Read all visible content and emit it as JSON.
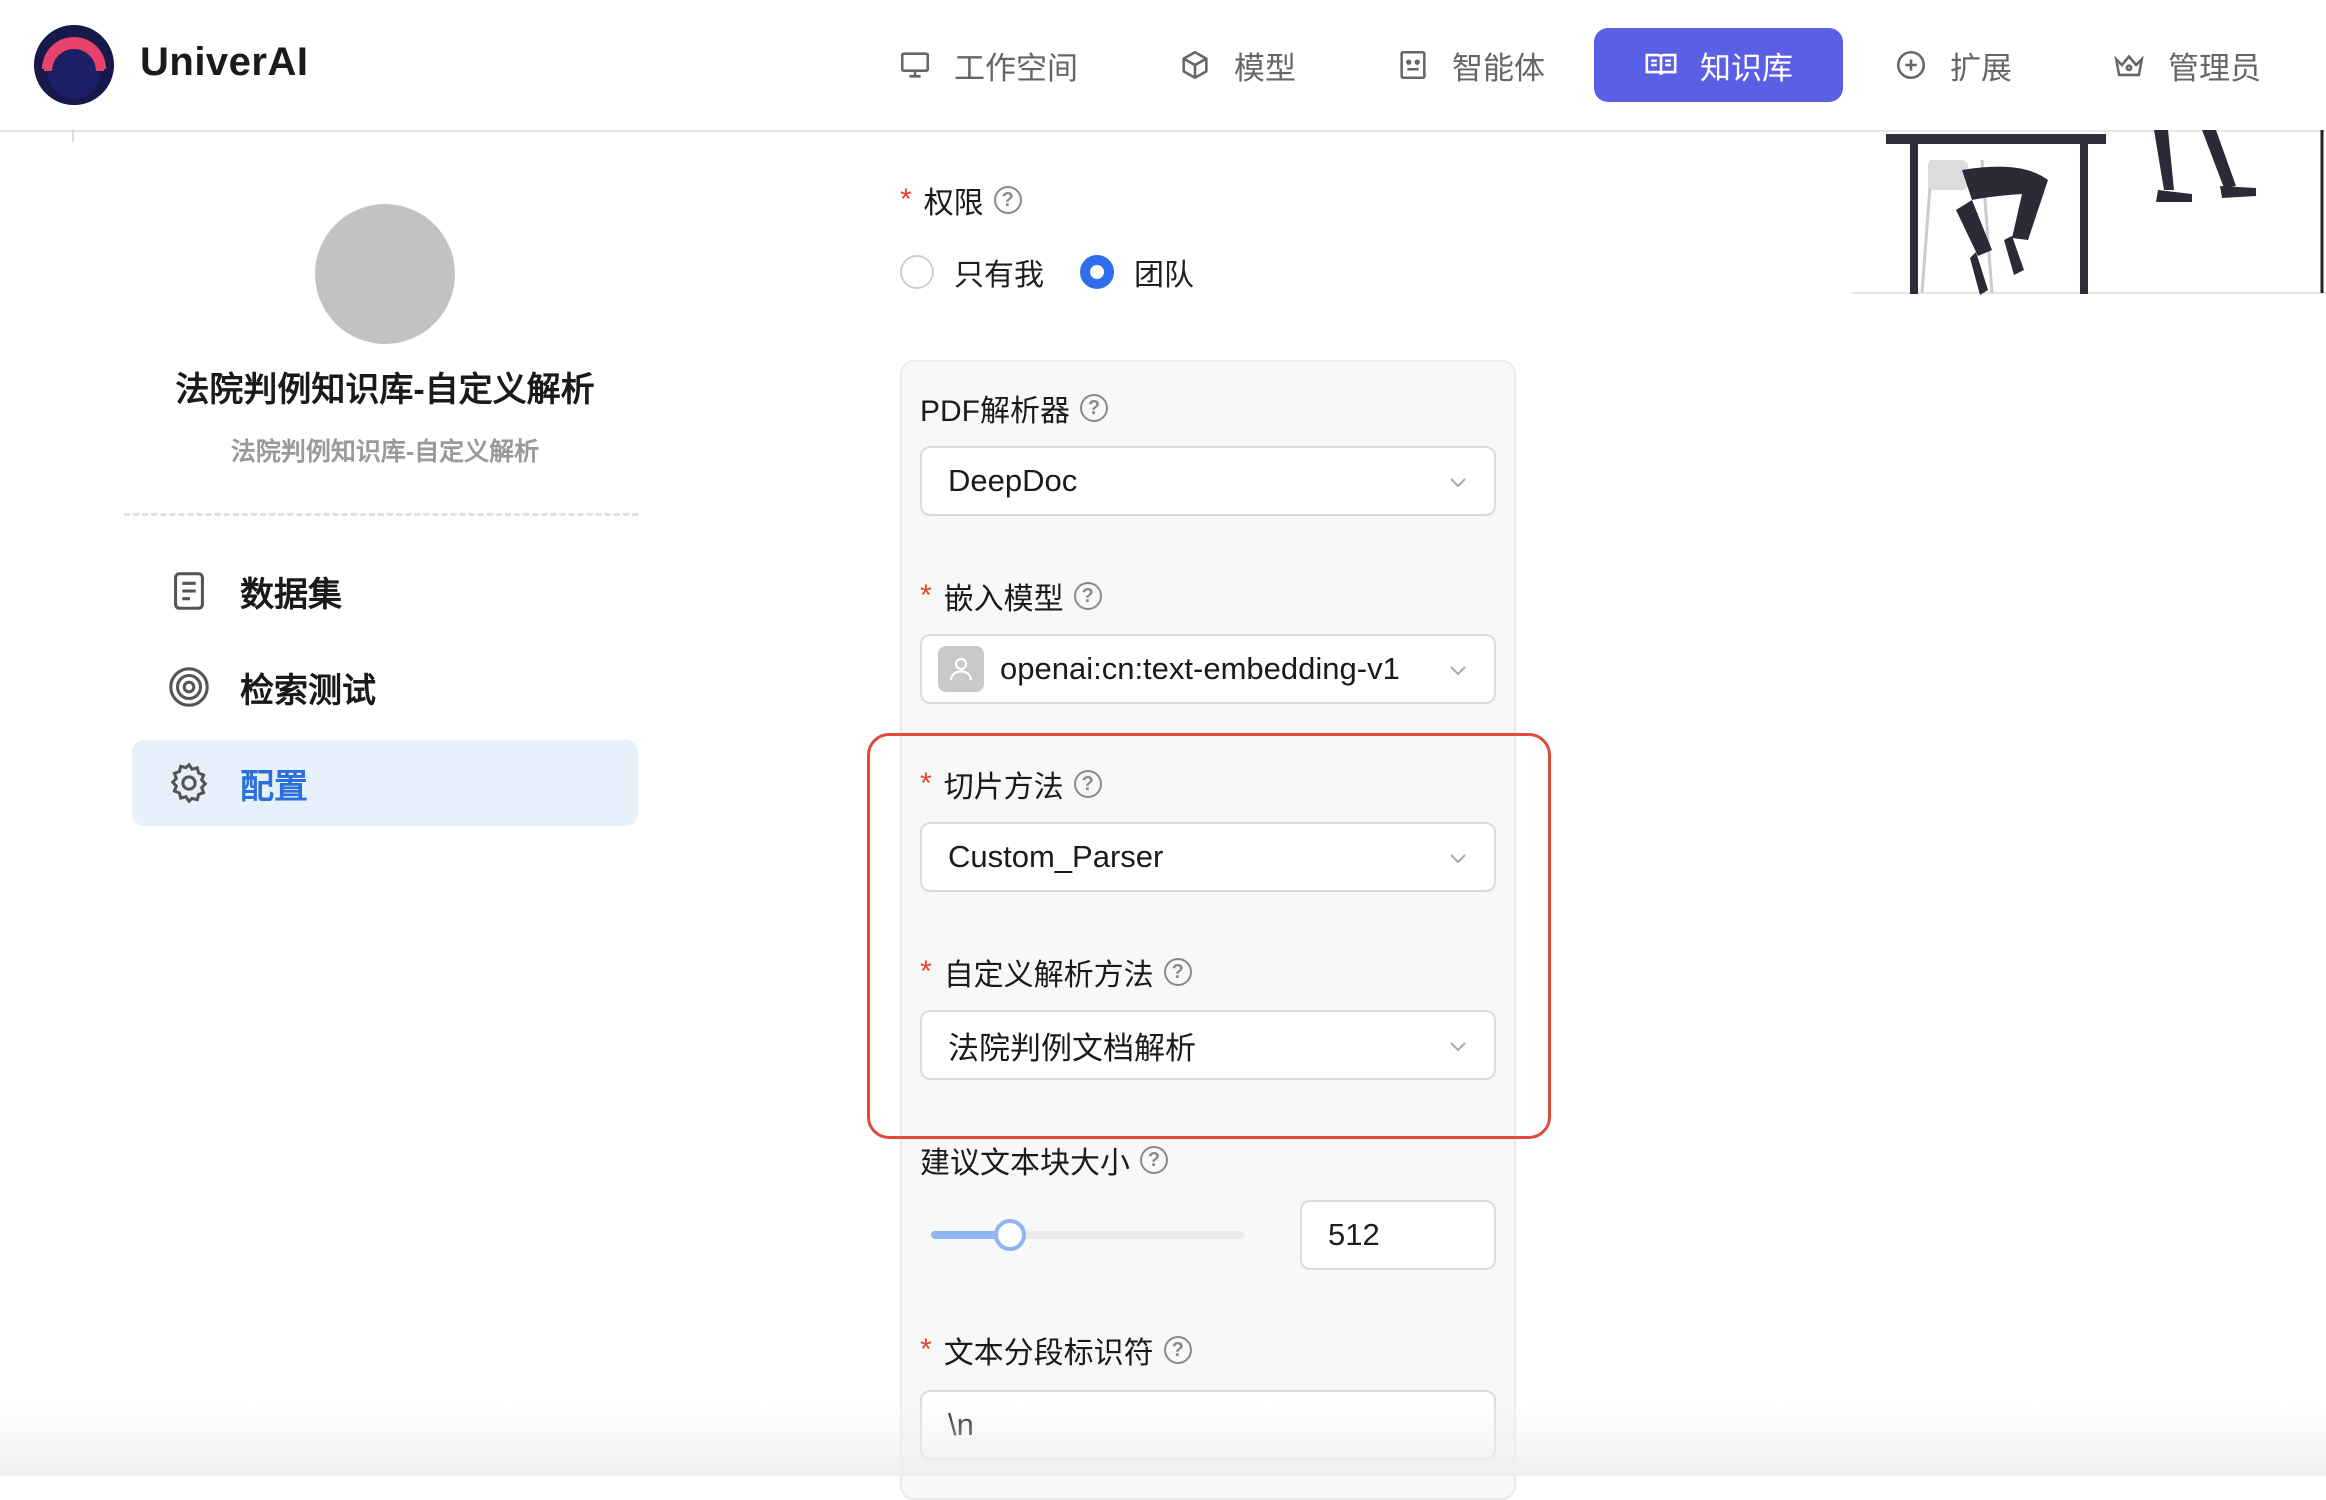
{
  "header": {
    "brand": "UniverAI",
    "nav": [
      {
        "label": "工作空间",
        "icon": "monitor-icon"
      },
      {
        "label": "模型",
        "icon": "cube-icon"
      },
      {
        "label": "智能体",
        "icon": "bot-icon"
      },
      {
        "label": "知识库",
        "icon": "book-icon",
        "active": true
      },
      {
        "label": "扩展",
        "icon": "plus-circle-icon"
      },
      {
        "label": "管理员",
        "icon": "crown-icon"
      }
    ]
  },
  "sidebar": {
    "kb_title": "法院判例知识库-自定义解析",
    "kb_subtitle": "法院判例知识库-自定义解析",
    "menu": [
      {
        "label": "数据集",
        "icon": "document-icon"
      },
      {
        "label": "检索测试",
        "icon": "target-icon"
      },
      {
        "label": "配置",
        "icon": "gear-icon",
        "active": true
      }
    ]
  },
  "form": {
    "permission": {
      "label": "权限",
      "options": [
        "只有我",
        "团队"
      ],
      "selected": "团队"
    },
    "pdf_parser": {
      "label": "PDF解析器",
      "value": "DeepDoc"
    },
    "embedding_model": {
      "label": "嵌入模型",
      "value": "openai:cn:text-embedding-v1"
    },
    "chunk_method": {
      "label": "切片方法",
      "value": "Custom_Parser"
    },
    "custom_parse_method": {
      "label": "自定义解析方法",
      "value": "法院判例文档解析"
    },
    "chunk_size": {
      "label": "建议文本块大小",
      "value": "512",
      "slider_fraction": 0.25
    },
    "delimiter": {
      "label": "文本分段标识符",
      "value": "\\n"
    }
  },
  "colors": {
    "accent": "#5b5fe6",
    "radio_active": "#2f6ee8",
    "required": "#e8412d",
    "highlight_border": "#e04a3a",
    "menu_active_bg": "#e6f1fc"
  }
}
